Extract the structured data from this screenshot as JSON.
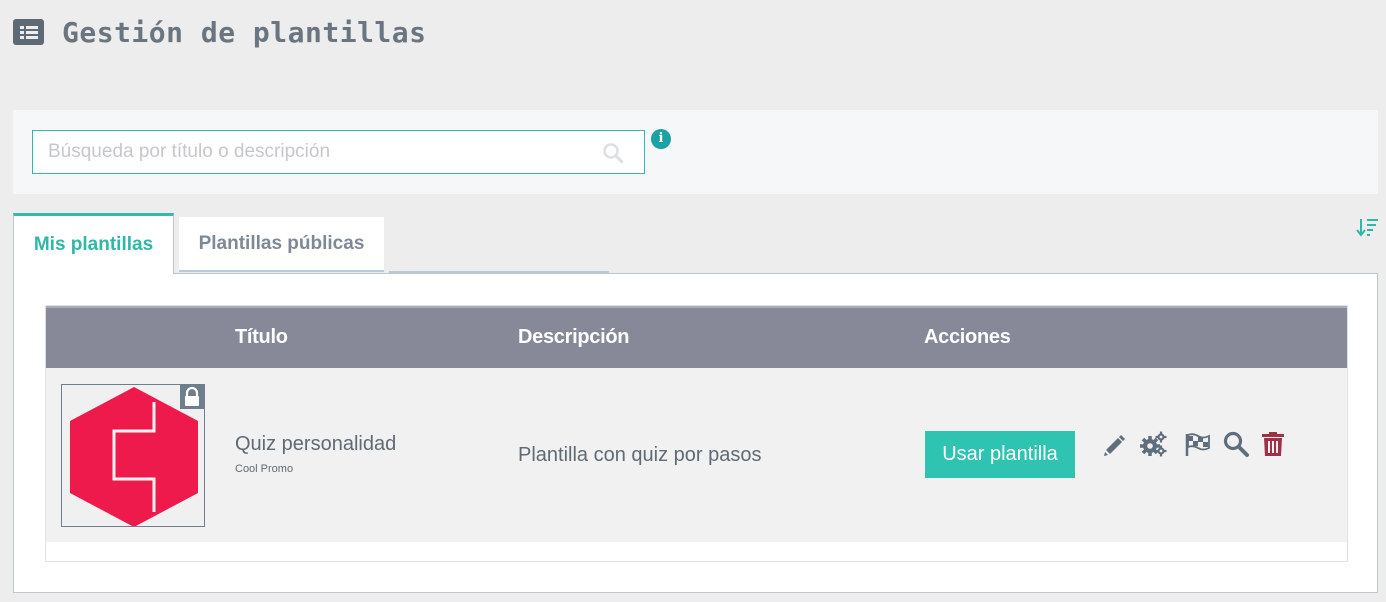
{
  "page": {
    "title": "Gestión de plantillas"
  },
  "search": {
    "placeholder": "Búsqueda por título o descripción"
  },
  "tabs": [
    {
      "label": "Mis plantillas",
      "active": true
    },
    {
      "label": "Plantillas públicas",
      "active": false
    }
  ],
  "table": {
    "headers": {
      "title": "Título",
      "description": "Descripción",
      "actions": "Acciones"
    },
    "rows": [
      {
        "title": "Quiz personalidad",
        "subtitle": "Cool Promo",
        "description": "Plantilla con quiz por pasos",
        "use_button": "Usar plantilla",
        "locked": true,
        "actions": [
          "pencil-icon",
          "gears-icon",
          "checkered-flag-icon",
          "magnifier-icon",
          "trash-icon"
        ]
      }
    ]
  },
  "colors": {
    "accent": "#2ec4b1",
    "header": "#878898",
    "logo": "#ee1a4c",
    "trash": "#a03045",
    "action_icon": "#5e6e7c"
  },
  "icons": {
    "header": "list-icon",
    "search": "search-icon",
    "info": "info-icon",
    "sort": "sort-descending-icon"
  }
}
